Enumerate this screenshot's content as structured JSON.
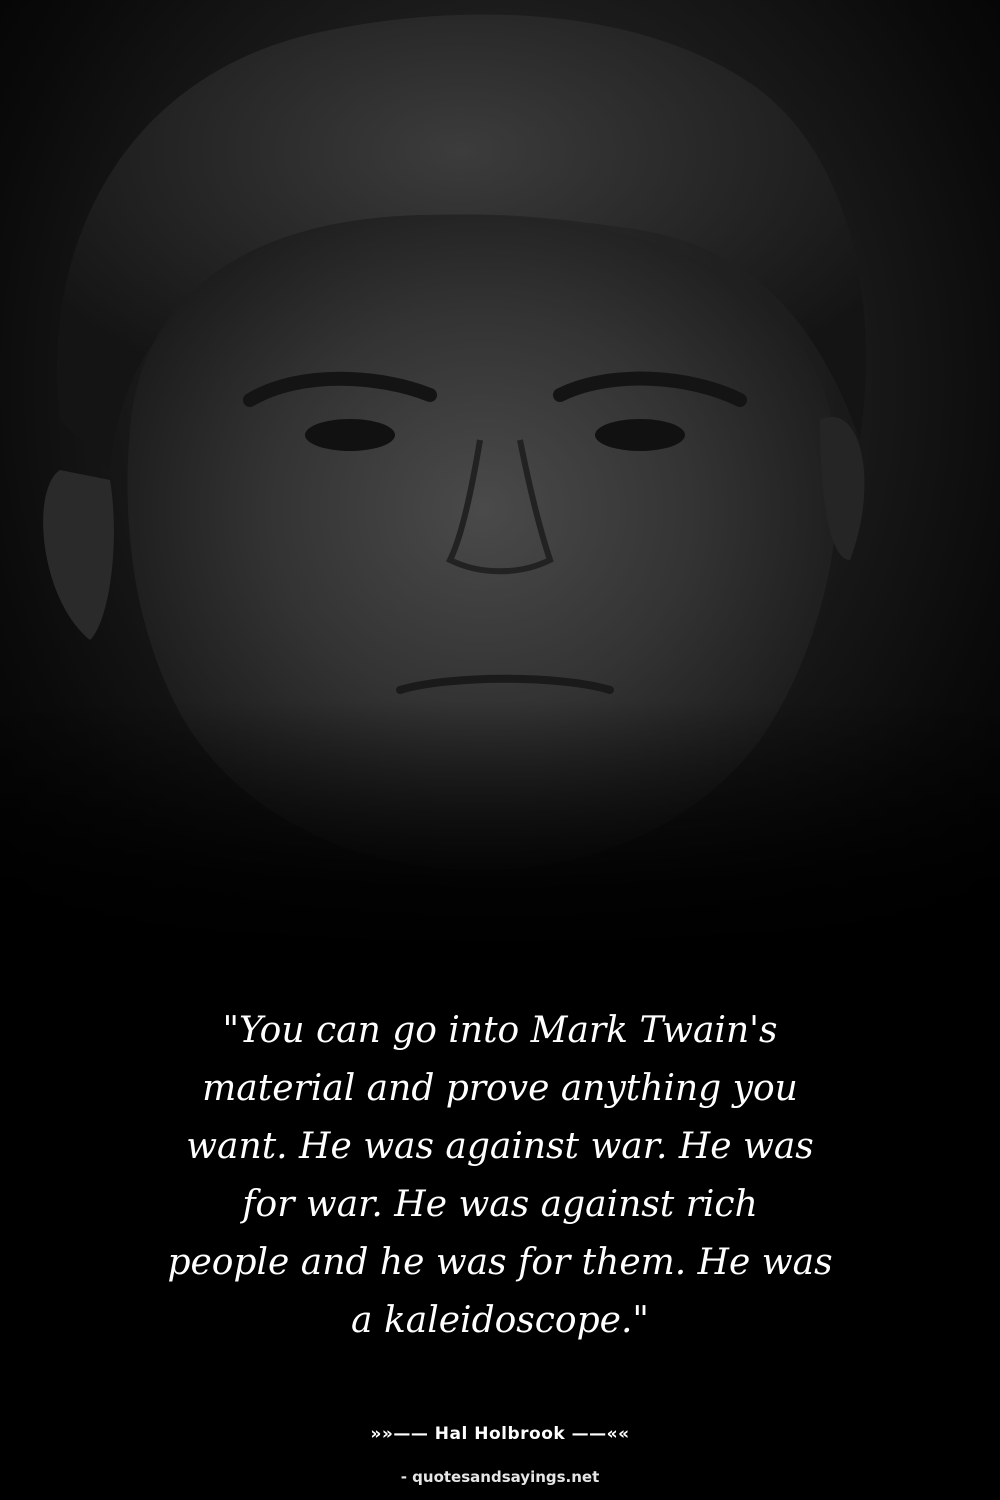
{
  "photo": {
    "subject": "portrait-photo",
    "tone": "black-and-white",
    "background_color": "#000000"
  },
  "quote": {
    "lines": [
      "\"You can go into Mark Twain's",
      "material and prove anything you",
      "want. He was against war. He was",
      "for war. He was against rich",
      "people and he was for them. He was",
      "a kaleidoscope.\""
    ],
    "color": "#ffffff"
  },
  "author": {
    "text": "»»—— Hal Holbrook ——««"
  },
  "source": {
    "text": "- quotesandsayings.net"
  }
}
